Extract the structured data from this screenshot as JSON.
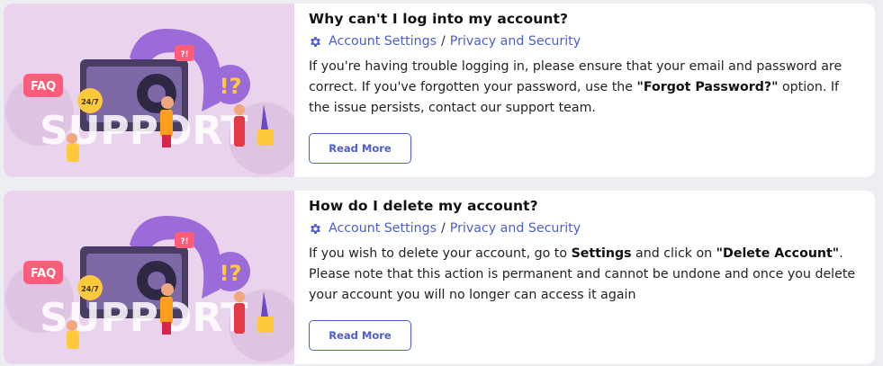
{
  "colors": {
    "accent": "#4c5ec9",
    "thumb_bg": "#ead3ec",
    "illustration_purple": "#9b6bd9"
  },
  "faqs": [
    {
      "title": "Why can't I log into my account?",
      "category": "Account Settings",
      "separator": "/",
      "subcategory": "Privacy and Security",
      "desc_1": "If you're having trouble logging in, please ensure that your email and password are correct. If you've forgotten your password, use the ",
      "desc_bold_1": "\"Forgot Password?\"",
      "desc_2": " option. If the issue persists, contact our support team.",
      "button": "Read More"
    },
    {
      "title": "How do I delete my account?",
      "category": "Account Settings",
      "separator": "/",
      "subcategory": "Privacy and Security",
      "desc_1": "If you wish to delete your account, go to ",
      "desc_bold_1": "Settings",
      "desc_2": "  and click on ",
      "desc_bold_2": "\"Delete Account\"",
      "desc_3": ". Please note that this action is permanent and cannot be undone and once you delete your account you will no longer can access it again",
      "button": "Read More"
    }
  ],
  "illustration": {
    "big_text": "SUPPORT",
    "faq_badge": "FAQ",
    "hours_badge": "24/7",
    "alert_bubble": "!?",
    "small_bubble": "?!",
    "icon": "support-illustration"
  }
}
